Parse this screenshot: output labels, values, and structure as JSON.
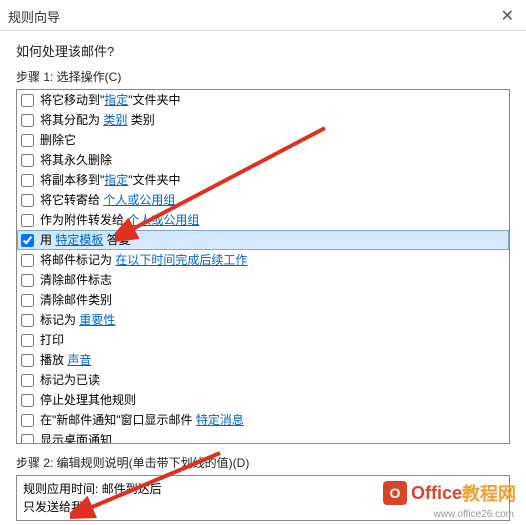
{
  "titlebar": {
    "title": "规则向导"
  },
  "prompt": "如何处理该邮件?",
  "step1": {
    "label": "步骤 1: 选择操作(C)",
    "items": [
      {
        "checked": false,
        "pre": "将它移动到\"",
        "link": "指定",
        "post": "\"文件夹中"
      },
      {
        "checked": false,
        "pre": "将其分配为 ",
        "link": "类别",
        "post": " 类别"
      },
      {
        "checked": false,
        "pre": "删除它",
        "link": "",
        "post": ""
      },
      {
        "checked": false,
        "pre": "将其永久删除",
        "link": "",
        "post": ""
      },
      {
        "checked": false,
        "pre": "将副本移到\"",
        "link": "指定",
        "post": "\"文件夹中"
      },
      {
        "checked": false,
        "pre": "将它转寄给 ",
        "link": "个人或公用组",
        "post": ""
      },
      {
        "checked": false,
        "pre": "作为附件转发给 ",
        "link": "个人或公用组",
        "post": ""
      },
      {
        "checked": true,
        "pre": "用 ",
        "link": "特定模板",
        "post": " 答复",
        "selected": true
      },
      {
        "checked": false,
        "pre": "将邮件标记为 ",
        "link": "在以下时间完成后续工作",
        "post": ""
      },
      {
        "checked": false,
        "pre": "清除邮件标志",
        "link": "",
        "post": ""
      },
      {
        "checked": false,
        "pre": "清除邮件类别",
        "link": "",
        "post": ""
      },
      {
        "checked": false,
        "pre": "标记为 ",
        "link": "重要性",
        "post": ""
      },
      {
        "checked": false,
        "pre": "打印",
        "link": "",
        "post": ""
      },
      {
        "checked": false,
        "pre": "播放 ",
        "link": "声音",
        "post": ""
      },
      {
        "checked": false,
        "pre": "标记为已读",
        "link": "",
        "post": ""
      },
      {
        "checked": false,
        "pre": "停止处理其他规则",
        "link": "",
        "post": ""
      },
      {
        "checked": false,
        "pre": "在\"新邮件通知\"窗口显示邮件 ",
        "link": "特定消息",
        "post": ""
      },
      {
        "checked": false,
        "pre": "显示桌面通知",
        "link": "",
        "post": ""
      }
    ]
  },
  "step2": {
    "label": "步骤 2: 编辑规则说明(单击带下划线的值)(D)",
    "line1": "规则应用时间: 邮件到达后",
    "line2": "只发送给我"
  },
  "watermark": {
    "brand1": "Office",
    "brand2": "教程网",
    "url": "www.office26.com"
  }
}
